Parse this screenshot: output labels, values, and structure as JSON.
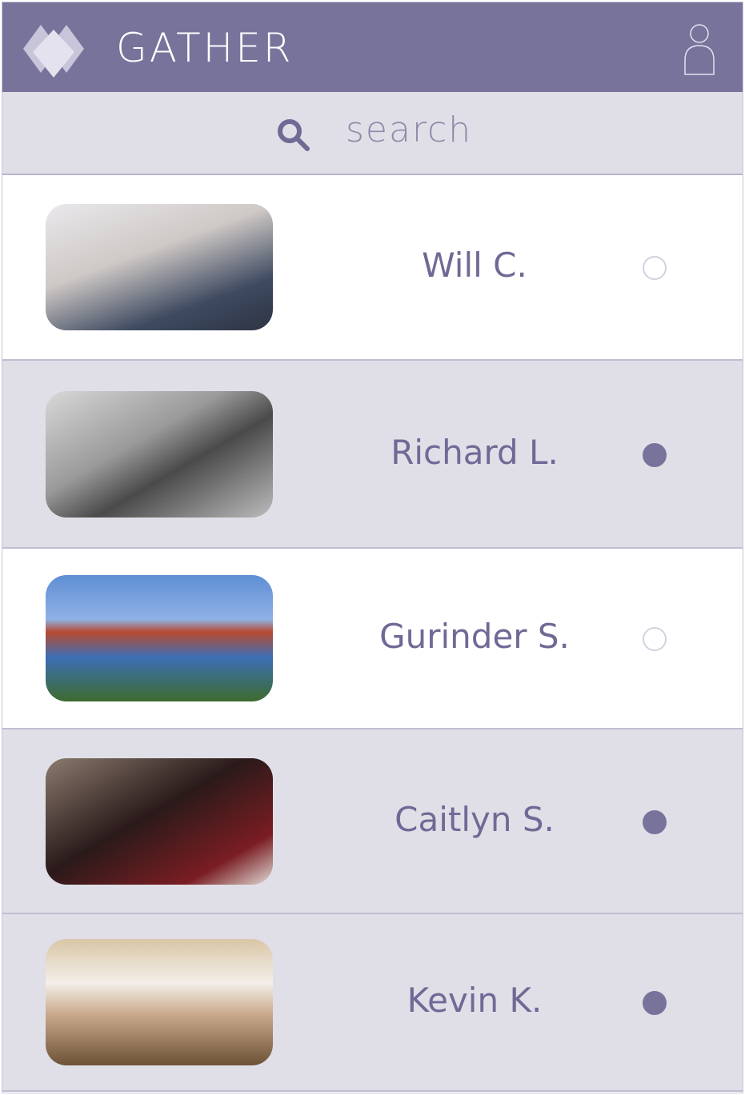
{
  "header": {
    "title": "GATHER",
    "logo_icon": "diamond-logo",
    "profile_icon": "user-icon",
    "color": "#77739b"
  },
  "search": {
    "placeholder": "search",
    "value": ""
  },
  "people": [
    {
      "name": "Will C.",
      "selected": false
    },
    {
      "name": "Richard L.",
      "selected": true
    },
    {
      "name": "Gurinder S.",
      "selected": false
    },
    {
      "name": "Caitlyn S.",
      "selected": true
    },
    {
      "name": "Kevin K.",
      "selected": true
    }
  ]
}
